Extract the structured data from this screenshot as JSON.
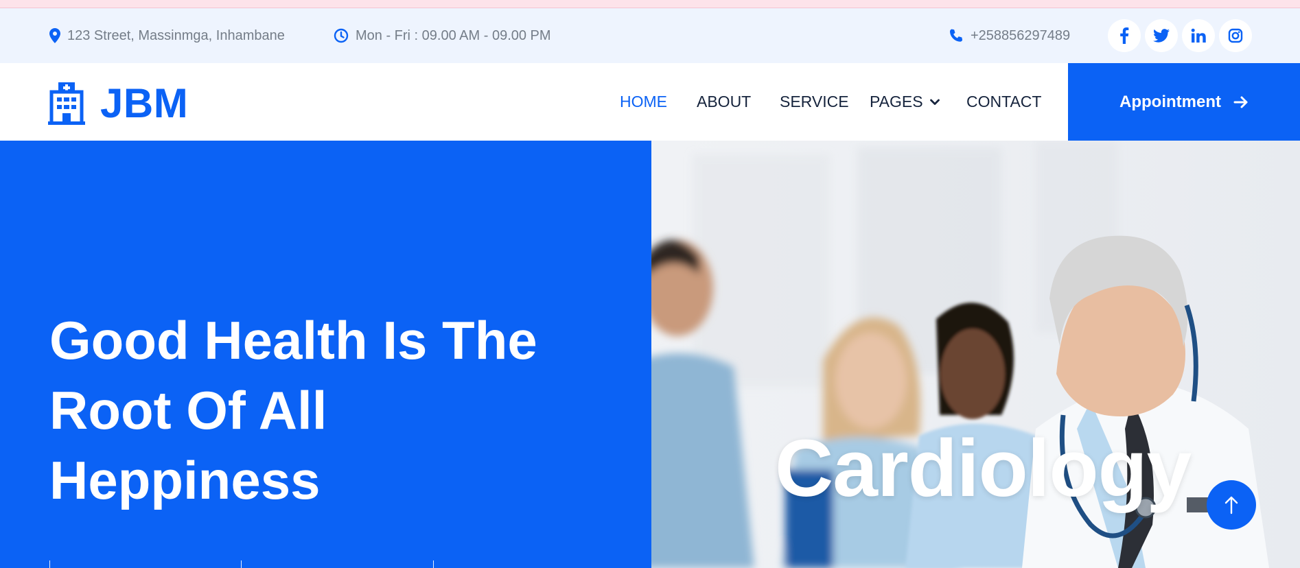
{
  "topbar": {
    "address": "123 Street, Massinmga, Inhambane",
    "hours": "Mon - Fri : 09.00 AM - 09.00 PM",
    "phone": "+258856297489",
    "socials": [
      {
        "icon": "facebook-icon",
        "glyph": "f"
      },
      {
        "icon": "twitter-icon",
        "glyph": ""
      },
      {
        "icon": "linkedin-icon",
        "glyph": "in"
      },
      {
        "icon": "instagram-icon",
        "glyph": ""
      }
    ]
  },
  "brand": {
    "name": "JBM",
    "icon": "hospital-icon"
  },
  "nav": {
    "items": [
      {
        "label": "HOME",
        "active": true
      },
      {
        "label": "ABOUT"
      },
      {
        "label": "SERVICE"
      },
      {
        "label": "PAGES",
        "dropdown": true
      },
      {
        "label": "CONTACT"
      }
    ],
    "cta_label": "Appointment"
  },
  "hero": {
    "title_line1": "Good Health Is The",
    "title_line2": "Root Of All",
    "title_line3": "Heppiness",
    "photo_caption": "Cardiology"
  },
  "colors": {
    "accent": "#0b62f5",
    "topbar_bg": "#eef4fe",
    "nav_text": "#15233c",
    "muted_text": "#747d88"
  }
}
